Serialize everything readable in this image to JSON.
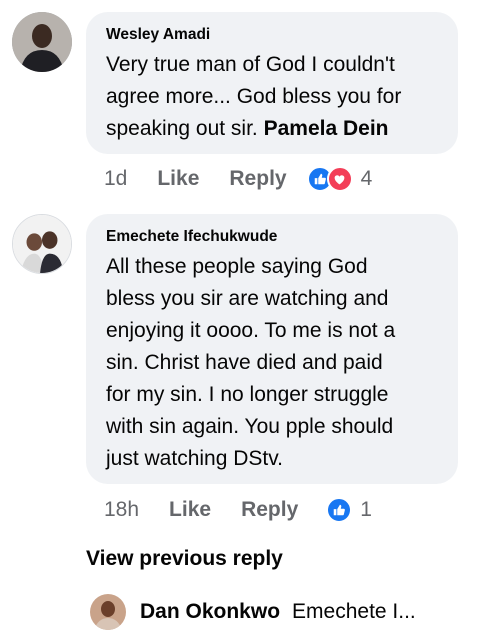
{
  "comments": [
    {
      "author": "Wesley Amadi",
      "lines": [
        "Very true man of God I couldn't",
        "agree more... God bless you for"
      ],
      "last_line_prefix": "speaking out sir.",
      "tag": "Pamela Dein",
      "time": "1d",
      "like_label": "Like",
      "reply_label": "Reply",
      "reaction_count": "4",
      "reactions": [
        "like-icon",
        "love-icon"
      ]
    },
    {
      "author": "Emechete Ifechukwude",
      "lines": [
        "All these people saying God",
        "bless you sir are watching and",
        "enjoying it oooo. To me is not a",
        "sin. Christ have died and paid",
        "for my sin. I no longer struggle",
        "with sin again. You pple should",
        "just watching DStv."
      ],
      "time": "18h",
      "like_label": "Like",
      "reply_label": "Reply",
      "reaction_count": "1",
      "reactions": [
        "like-icon"
      ]
    }
  ],
  "view_previous_reply": "View previous reply",
  "reply_preview": {
    "author": "Dan Okonkwo",
    "text": "Emechete I..."
  },
  "colors": {
    "bubble": "#f0f2f5",
    "like_blue": "#1877f2",
    "love_red": "#f33e58",
    "meta_gray": "#65676b"
  }
}
